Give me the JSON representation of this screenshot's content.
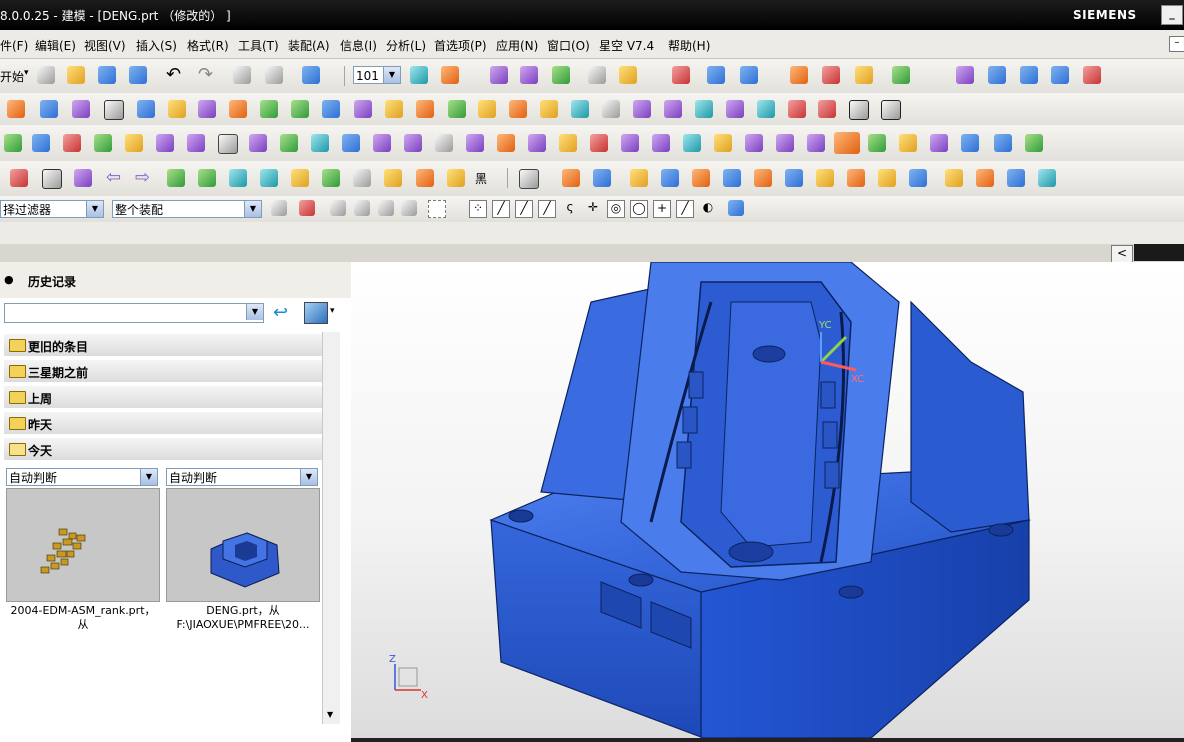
{
  "window": {
    "title": "8.0.0.25 - 建模 - [DENG.prt （修改的） ]",
    "brand": "SIEMENS"
  },
  "menu": [
    "件(F)",
    "编辑(E)",
    "视图(V)",
    "插入(S)",
    "格式(R)",
    "工具(T)",
    "装配(A)",
    "信息(I)",
    "分析(L)",
    "首选项(P)",
    "应用(N)",
    "窗口(O)",
    "星空 V7.4",
    "帮助(H)"
  ],
  "toolbar": {
    "start_label": "开始",
    "layer_value": "101",
    "black_label": "黑",
    "filter_value": "择过滤器",
    "assembly_scope_value": "整个装配"
  },
  "history": {
    "title": "历史记录",
    "search_value": "",
    "groups": [
      "更旧的条目",
      "三星期之前",
      "上周",
      "昨天",
      "今天"
    ],
    "items": [
      {
        "filter": "自动判断",
        "caption": "2004-EDM-ASM_rank.prt，从"
      },
      {
        "filter": "自动判断",
        "caption": "DENG.prt，从 F:\\JIAOXUE\\PMFREE\\20..."
      }
    ]
  },
  "viewport": {
    "axis_labels": {
      "yc": "YC",
      "xc": "XC",
      "z": "Z",
      "x": "X"
    },
    "model_color": "#2f63d8",
    "background": "#f3f3f3"
  },
  "colors": {
    "titlebar": "#000000",
    "menubar": "#ecebe6",
    "toolbar": "#ecebe6"
  }
}
